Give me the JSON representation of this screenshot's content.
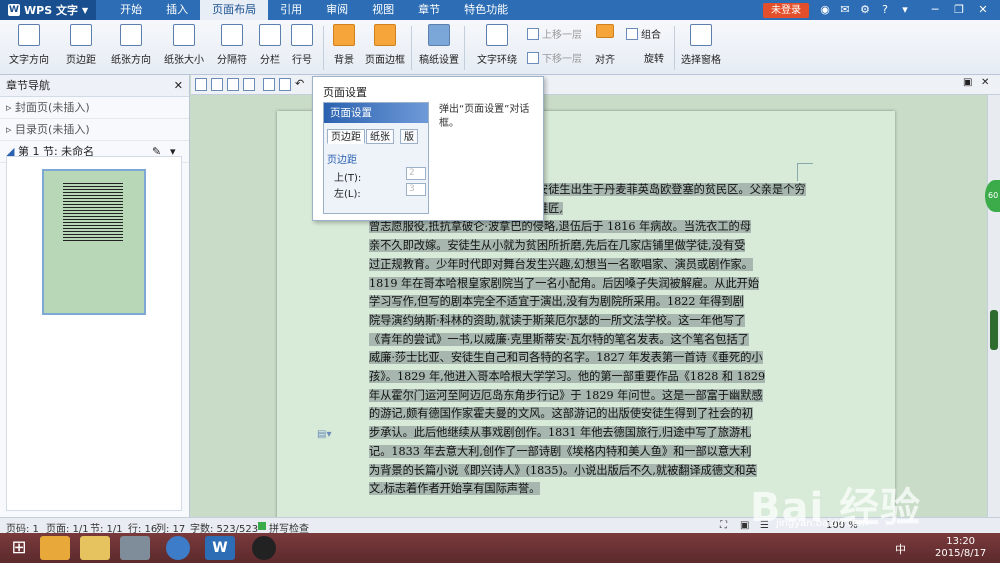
{
  "app": {
    "name": "WPS 文字"
  },
  "menu": [
    "开始",
    "插入",
    "页面布局",
    "引用",
    "审阅",
    "视图",
    "章节",
    "特色功能"
  ],
  "active_menu": "页面布局",
  "login_label": "未登录",
  "ribbon": {
    "buttons": [
      "文字方向",
      "页边距",
      "纸张方向",
      "纸张大小",
      "分隔符",
      "分栏",
      "行号",
      "背景",
      "页面边框",
      "稿纸设置",
      "文字环绕",
      "对齐",
      "旋转",
      "选择窗格"
    ],
    "small": {
      "up": "上移一层",
      "down": "下移一层",
      "group": "组合"
    }
  },
  "nav": {
    "title": "章节导航",
    "items": [
      "封面页(未插入)",
      "目录页(未插入)"
    ],
    "section": "第 1 节: 未命名"
  },
  "tooltip": {
    "title": "页面设置",
    "desc": "弹出“页面设置”对话框。",
    "img_title": "页面设置",
    "tab1": "页边距",
    "tab2": "纸张",
    "tab3": "版",
    "section": "页边距",
    "f1": "上(T):",
    "f2": "左(L):",
    "val1": "2",
    "val2": "3"
  },
  "document": {
    "lines": [
      "安徒生出生于丹麦菲英岛欧登塞的贫民区。父亲是个穷鞋匠,",
      "曾志愿服役,抵抗拿破仑·波拿巴的侵略,退伍后于 1816 年病故。当洗衣工的母",
      "亲不久即改嫁。安徒生从小就为贫困所折磨,先后在几家店铺里做学徒,没有受",
      "过正规教育。少年时代即对舞台发生兴趣,幻想当一名歌唱家、演员或剧作家。",
      "1819 年在哥本哈根皇家剧院当了一名小配角。后因嗓子失润被解雇。从此开始",
      "学习写作,但写的剧本完全不适宜于演出,没有为剧院所采用。1822 年得到剧",
      "院导演约纳斯·科林的资助,就读于斯莱厄尔瑟的一所文法学校。这一年他写了",
      "《青年的尝试》一书,以威廉·克里斯蒂安·瓦尔特的笔名发表。这个笔名包括了",
      "威廉·莎士比亚、安徒生自己和司各特的名字。1827 年发表第一首诗《垂死的小",
      "孩》。1829 年,他进入哥本哈根大学学习。他的第一部重要作品《1828 和 1829",
      "年从霍尔门运河至阿迈厄岛东角步行记》于 1829 年问世。这是一部富于幽默感",
      "的游记,颇有德国作家霍夫曼的文风。这部游记的出版使安徒生得到了社会的初",
      "步承认。此后他继续从事戏剧创作。1831 年他去德国旅行,归途中写了旅游札",
      "记。1833 年去意大利,创作了一部诗剧《埃格内特和美人鱼》和一部以意大利",
      "为背景的长篇小说《即兴诗人》(1835)。小说出版后不久,就被翻译成德文和英",
      "文,标志着作者开始享有国际声誉。"
    ]
  },
  "status": {
    "page": "页码: 1",
    "pages": "页面: 1/1",
    "section": "节: 1/1",
    "row": "行: 16",
    "col": "列: 17",
    "words": "字数: 523/523",
    "spell": "拼写检查",
    "zoom": "100 %"
  },
  "watermark": {
    "brand": "Bai 经验",
    "url": "jingyan.baidu.com"
  },
  "clock": {
    "time": "13:20",
    "date": "2015/8/17"
  },
  "tray": {
    "ime": "中"
  },
  "bubble": "60"
}
